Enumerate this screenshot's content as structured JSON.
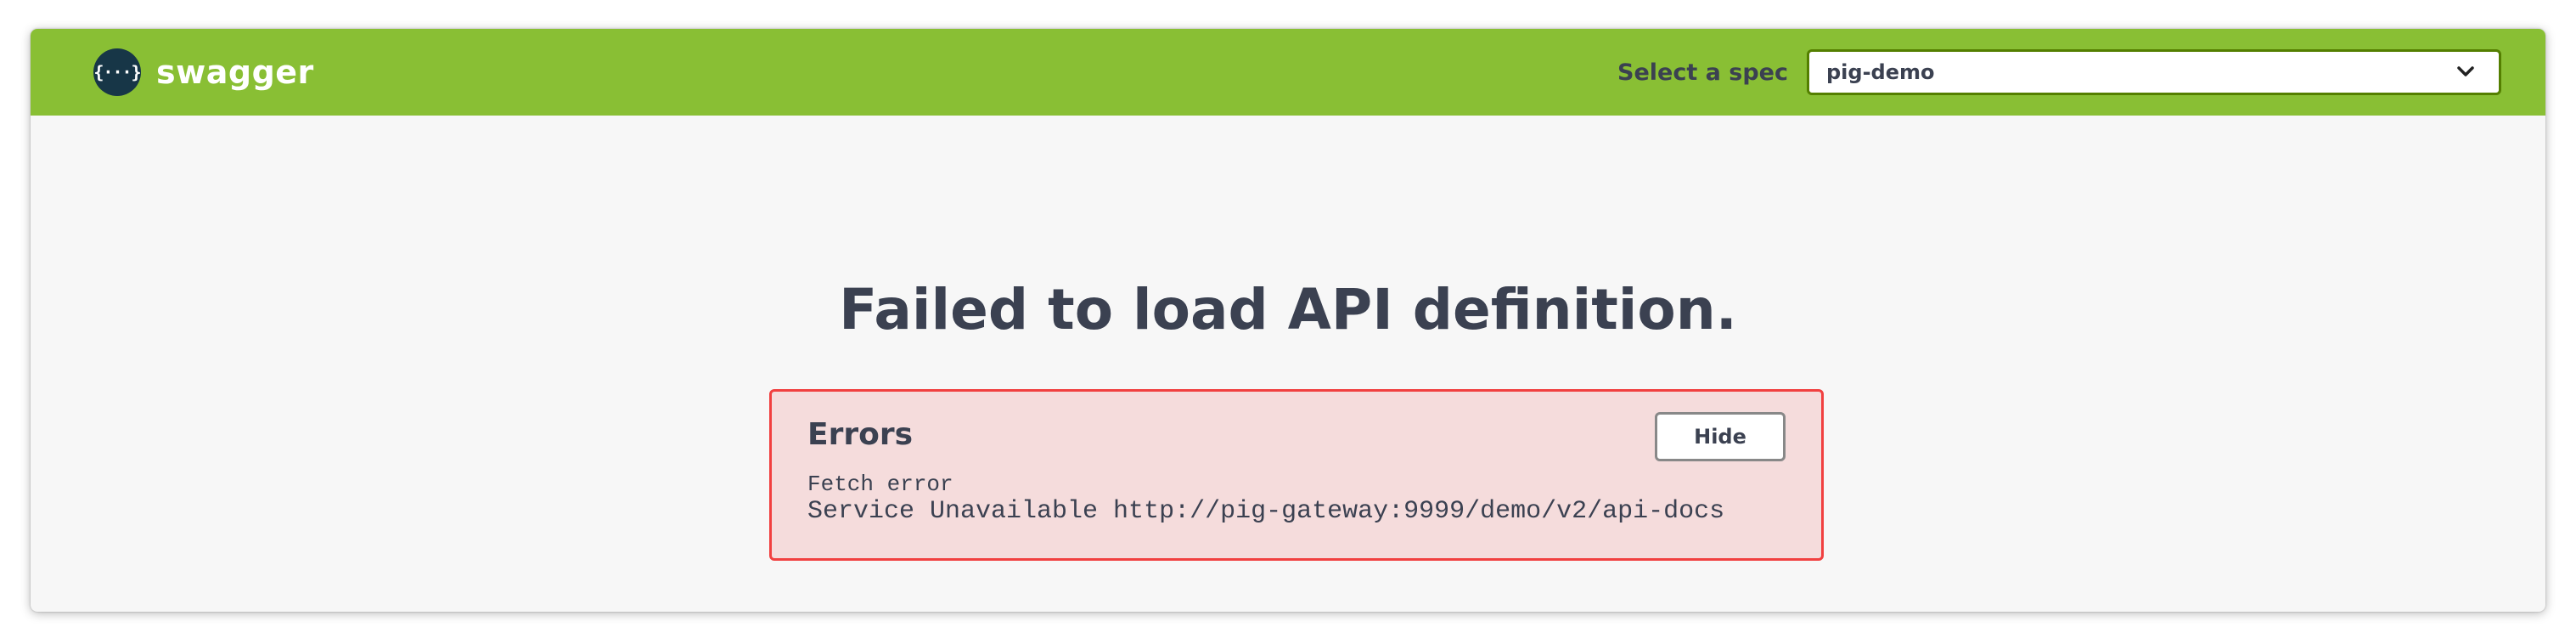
{
  "topbar": {
    "logo_glyph": "{···}",
    "logo_text": "swagger",
    "spec_label": "Select a spec",
    "spec_selected": "pig-demo"
  },
  "main": {
    "title": "Failed to load API definition."
  },
  "errors": {
    "heading": "Errors",
    "hide_label": "Hide",
    "source": "Fetch error",
    "message": "Service Unavailable http://pig-gateway:9999/demo/v2/api-docs"
  },
  "colors": {
    "topbar_bg": "#89bf34",
    "error_border": "#f14040",
    "error_bg": "#f5dcdc",
    "text": "#3b4151"
  }
}
